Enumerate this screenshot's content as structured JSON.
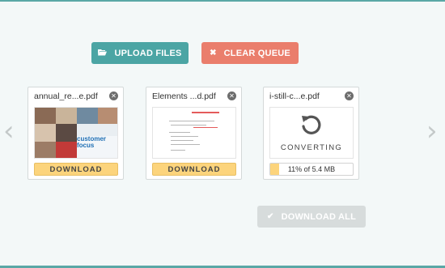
{
  "toolbar": {
    "upload_label": "UPLOAD FILES",
    "upload_icon": "folder-open-icon",
    "clear_label": "CLEAR QUEUE",
    "clear_icon": "x-icon",
    "upload_color": "#4ba5a4",
    "clear_color": "#ea7e6c"
  },
  "nav": {
    "prev_icon": "chevron-left-icon",
    "next_icon": "chevron-right-icon"
  },
  "files": [
    {
      "name": "annual_re...e.pdf",
      "status": "done",
      "action_label": "DOWNLOAD",
      "thumb": "collage",
      "thumb_text": "customer focus"
    },
    {
      "name": "Elements ...d.pdf",
      "status": "done",
      "action_label": "DOWNLOAD",
      "thumb": "document"
    },
    {
      "name": "i-still-c...e.pdf",
      "status": "converting",
      "status_label": "CONVERTING",
      "progress_fraction": 0.11,
      "progress_label": "11% of 5.4 MB"
    }
  ],
  "footer": {
    "download_all_label": "DOWNLOAD ALL",
    "download_all_icon": "check-icon",
    "download_all_enabled": false
  },
  "colors": {
    "accent": "#4ba5a4",
    "download": "#fcd47c",
    "disabled": "#d7dcdc"
  }
}
